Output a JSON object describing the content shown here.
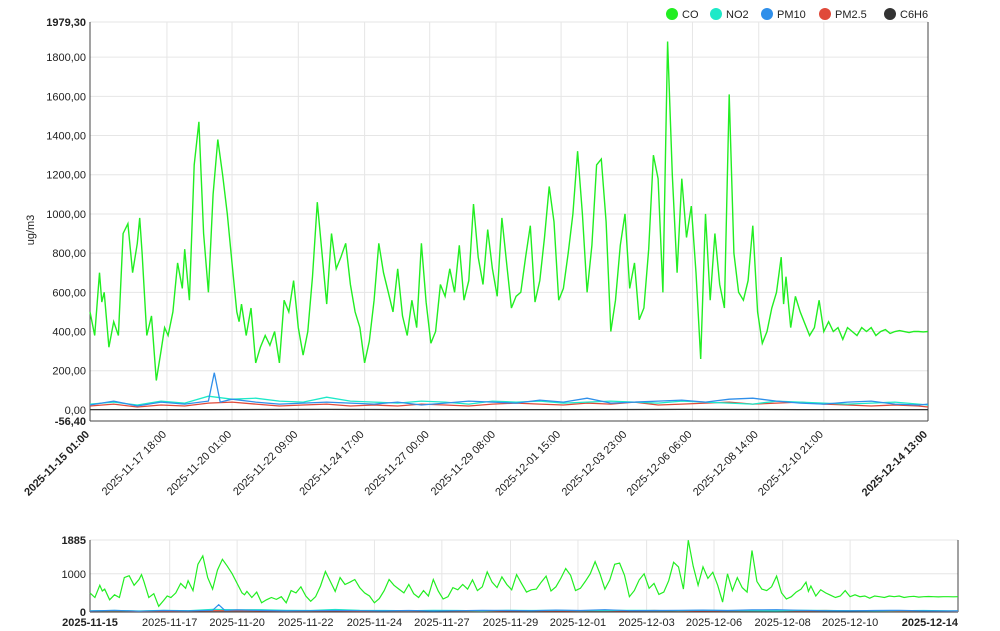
{
  "colors": {
    "CO": "#22ee22",
    "NO2": "#1de9c8",
    "PM10": "#2f8fea",
    "PM2.5": "#e04a3a",
    "C6H6": "#333333"
  },
  "chart_data": [
    {
      "type": "line",
      "ylabel": "ug/m3",
      "xlabel": "",
      "ylim": [
        -56.4,
        1979.3
      ],
      "xlim": [
        "2025-11-15 01:00",
        "2025-12-14 13:00"
      ],
      "legend_position": "top-right",
      "grid": true,
      "y_ticks": [
        "1979,30",
        "1800,00",
        "1600,00",
        "1400,00",
        "1200,00",
        "1000,00",
        "800,00",
        "600,00",
        "400,00",
        "200,00",
        "0,00",
        "-56,40"
      ],
      "y_tick_values": [
        1979.3,
        1800,
        1600,
        1400,
        1200,
        1000,
        800,
        600,
        400,
        200,
        0,
        -56.4
      ],
      "x_ticks": [
        "2025-11-15 01:00",
        "2025-11-17 18:00",
        "2025-11-20 01:00",
        "2025-11-22 09:00",
        "2025-11-24 17:00",
        "2025-11-27 00:00",
        "2025-11-29 08:00",
        "2025-12-01 15:00",
        "2025-12-03 23:00",
        "2025-12-06 06:00",
        "2025-12-08 14:00",
        "2025-12-10 21:00",
        "2025-12-14 13:00"
      ],
      "x_tick_values": [
        0,
        65,
        120,
        176,
        232,
        287,
        343,
        398,
        454,
        509,
        565,
        620,
        708
      ],
      "x_tick_bold": [
        true,
        false,
        false,
        false,
        false,
        false,
        false,
        false,
        false,
        false,
        false,
        false,
        true
      ],
      "series": [
        {
          "name": "CO",
          "x": [
            0,
            4,
            8,
            10,
            12,
            16,
            20,
            24,
            28,
            32,
            36,
            40,
            42,
            44,
            48,
            52,
            56,
            60,
            63,
            66,
            70,
            74,
            78,
            80,
            84,
            88,
            92,
            96,
            100,
            104,
            108,
            112,
            116,
            120,
            124,
            126,
            128,
            132,
            136,
            140,
            144,
            148,
            152,
            156,
            160,
            164,
            168,
            172,
            176,
            180,
            184,
            188,
            192,
            196,
            200,
            204,
            208,
            212,
            216,
            220,
            224,
            228,
            232,
            236,
            240,
            244,
            248,
            252,
            256,
            260,
            264,
            268,
            272,
            276,
            280,
            284,
            288,
            292,
            296,
            300,
            304,
            308,
            312,
            316,
            320,
            324,
            328,
            332,
            336,
            340,
            344,
            348,
            352,
            356,
            360,
            364,
            368,
            372,
            376,
            380,
            384,
            388,
            392,
            396,
            400,
            404,
            408,
            412,
            416,
            420,
            424,
            428,
            432,
            436,
            440,
            444,
            448,
            452,
            456,
            460,
            464,
            468,
            472,
            476,
            480,
            484,
            488,
            492,
            496,
            500,
            504,
            508,
            512,
            516,
            520,
            524,
            528,
            532,
            536,
            540,
            544,
            548,
            552,
            556,
            560,
            564,
            568,
            572,
            576,
            580,
            584,
            586,
            588,
            592,
            596,
            600,
            604,
            608,
            612,
            616,
            620,
            624,
            628,
            632,
            636,
            640,
            644,
            648,
            652,
            656,
            660,
            664,
            668,
            672,
            676,
            680,
            684,
            688,
            692,
            696,
            700,
            704,
            708
          ],
          "values": [
            500,
            380,
            700,
            550,
            600,
            320,
            450,
            380,
            900,
            950,
            700,
            850,
            980,
            800,
            380,
            480,
            150,
            300,
            420,
            380,
            500,
            750,
            620,
            820,
            560,
            1250,
            1470,
            900,
            600,
            1100,
            1380,
            1200,
            1000,
            750,
            500,
            450,
            540,
            380,
            520,
            240,
            320,
            380,
            330,
            400,
            240,
            560,
            500,
            660,
            420,
            280,
            400,
            680,
            1060,
            800,
            540,
            900,
            720,
            780,
            850,
            640,
            500,
            420,
            240,
            350,
            560,
            850,
            700,
            600,
            500,
            720,
            480,
            380,
            560,
            420,
            850,
            550,
            340,
            400,
            640,
            580,
            720,
            600,
            840,
            560,
            660,
            1050,
            780,
            640,
            920,
            720,
            580,
            980,
            750,
            520,
            580,
            600,
            780,
            940,
            550,
            660,
            880,
            1140,
            960,
            560,
            620,
            800,
            1000,
            1320,
            1000,
            600,
            840,
            1250,
            1280,
            960,
            400,
            560,
            840,
            1000,
            620,
            750,
            460,
            520,
            820,
            1300,
            1180,
            600,
            1880,
            1200,
            700,
            1180,
            880,
            1040,
            700,
            260,
            1000,
            560,
            900,
            640,
            520,
            1610,
            800,
            600,
            560,
            660,
            940,
            500,
            340,
            400,
            520,
            600,
            780,
            540,
            680,
            420,
            580,
            500,
            440,
            380,
            420,
            560,
            400,
            450,
            400,
            420,
            360,
            420,
            400,
            380,
            420,
            400,
            420,
            380,
            400,
            410,
            390,
            400,
            405,
            400,
            395,
            400,
            400,
            398,
            400
          ]
        },
        {
          "name": "NO2",
          "x": [
            0,
            20,
            40,
            60,
            80,
            100,
            120,
            140,
            160,
            180,
            200,
            220,
            240,
            260,
            280,
            300,
            320,
            340,
            360,
            380,
            400,
            420,
            440,
            460,
            480,
            500,
            520,
            540,
            560,
            580,
            600,
            620,
            640,
            660,
            680,
            700,
            708
          ],
          "values": [
            30,
            40,
            25,
            45,
            35,
            70,
            55,
            60,
            45,
            40,
            65,
            45,
            40,
            35,
            45,
            40,
            30,
            45,
            40,
            45,
            35,
            40,
            45,
            40,
            35,
            45,
            40,
            35,
            30,
            45,
            40,
            35,
            30,
            35,
            40,
            30,
            25
          ]
        },
        {
          "name": "PM10",
          "x": [
            0,
            20,
            40,
            60,
            80,
            100,
            105,
            110,
            120,
            140,
            160,
            180,
            200,
            220,
            240,
            260,
            280,
            300,
            320,
            340,
            360,
            380,
            400,
            420,
            440,
            460,
            480,
            500,
            520,
            540,
            560,
            580,
            600,
            620,
            640,
            660,
            680,
            700,
            708
          ],
          "values": [
            25,
            45,
            20,
            40,
            30,
            45,
            190,
            40,
            55,
            40,
            30,
            35,
            40,
            35,
            30,
            40,
            25,
            35,
            45,
            40,
            35,
            50,
            40,
            60,
            35,
            40,
            45,
            50,
            40,
            55,
            60,
            45,
            35,
            30,
            40,
            45,
            30,
            25,
            30
          ]
        },
        {
          "name": "PM2.5",
          "x": [
            0,
            20,
            40,
            60,
            80,
            100,
            120,
            140,
            160,
            180,
            200,
            220,
            240,
            260,
            280,
            300,
            320,
            340,
            360,
            380,
            400,
            420,
            440,
            460,
            480,
            500,
            520,
            540,
            560,
            580,
            600,
            620,
            640,
            660,
            680,
            700,
            708
          ],
          "values": [
            20,
            30,
            15,
            25,
            20,
            35,
            40,
            30,
            20,
            25,
            30,
            20,
            25,
            20,
            30,
            25,
            20,
            30,
            35,
            30,
            25,
            35,
            30,
            40,
            25,
            30,
            35,
            40,
            30,
            35,
            40,
            30,
            25,
            20,
            25,
            20,
            15
          ]
        },
        {
          "name": "C6H6",
          "x": [
            0,
            100,
            200,
            300,
            400,
            500,
            600,
            708
          ],
          "values": [
            2,
            2,
            3,
            2,
            2,
            3,
            2,
            2
          ]
        }
      ]
    },
    {
      "type": "line",
      "ylim": [
        0,
        1885
      ],
      "y_ticks": [
        "1885",
        "1000",
        "0"
      ],
      "y_tick_values": [
        1885,
        1000,
        0
      ],
      "x_ticks": [
        "2025-11-15",
        "2025-11-17",
        "2025-11-20",
        "2025-11-22",
        "2025-11-24",
        "2025-11-27",
        "2025-11-29",
        "2025-12-01",
        "2025-12-03",
        "2025-12-06",
        "2025-12-08",
        "2025-12-10",
        "2025-12-14"
      ],
      "x_tick_values": [
        0,
        65,
        120,
        176,
        232,
        287,
        343,
        398,
        454,
        509,
        565,
        620,
        708
      ],
      "x_tick_bold": [
        true,
        false,
        false,
        false,
        false,
        false,
        false,
        false,
        false,
        false,
        false,
        false,
        true
      ]
    }
  ]
}
